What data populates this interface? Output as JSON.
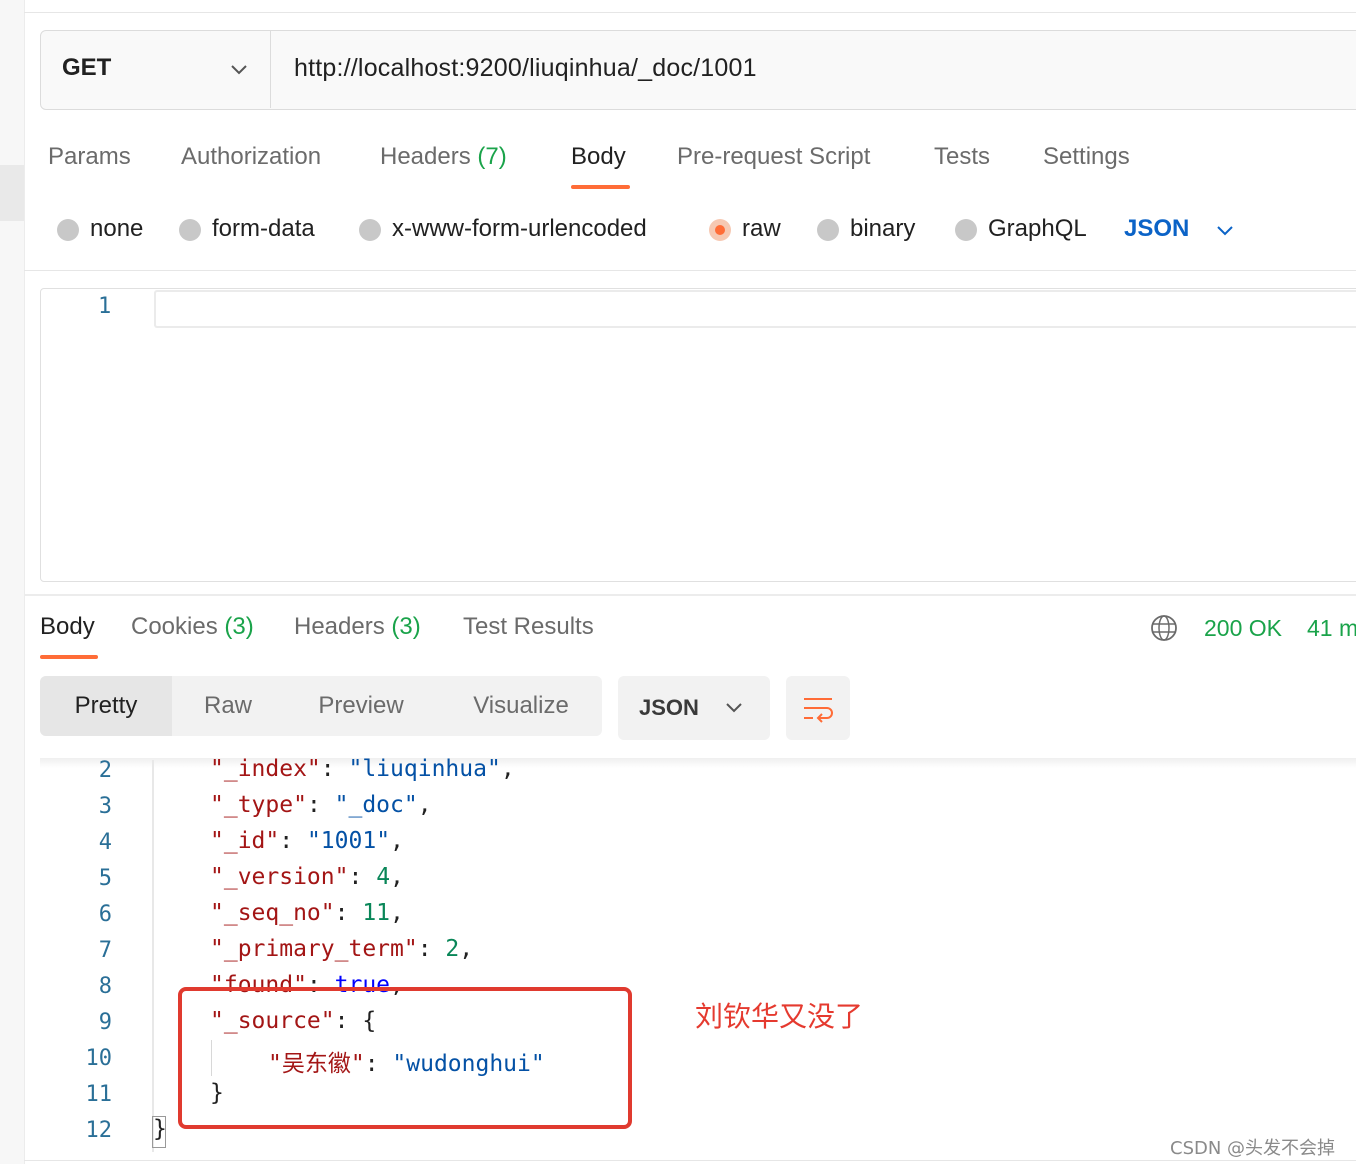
{
  "request": {
    "method": "GET",
    "url": "http://localhost:9200/liuqinhua/_doc/1001"
  },
  "request_tabs": [
    {
      "label": "Params",
      "count": ""
    },
    {
      "label": "Authorization",
      "count": ""
    },
    {
      "label": "Headers",
      "count": "(7)"
    },
    {
      "label": "Body",
      "count": "",
      "active": true
    },
    {
      "label": "Pre-request Script",
      "count": ""
    },
    {
      "label": "Tests",
      "count": ""
    },
    {
      "label": "Settings",
      "count": ""
    }
  ],
  "body_types": [
    {
      "label": "none",
      "selected": false
    },
    {
      "label": "form-data",
      "selected": false
    },
    {
      "label": "x-www-form-urlencoded",
      "selected": false
    },
    {
      "label": "raw",
      "selected": true
    },
    {
      "label": "binary",
      "selected": false
    },
    {
      "label": "GraphQL",
      "selected": false
    }
  ],
  "raw_format": "JSON",
  "editor": {
    "line_number": "1"
  },
  "response_tabs": [
    {
      "label": "Body",
      "count": "",
      "active": true
    },
    {
      "label": "Cookies",
      "count": "(3)"
    },
    {
      "label": "Headers",
      "count": "(3)"
    },
    {
      "label": "Test Results",
      "count": ""
    }
  ],
  "response_status": "200 OK",
  "response_time": "41 m",
  "view_modes": [
    "Pretty",
    "Raw",
    "Preview",
    "Visualize"
  ],
  "response_format": "JSON",
  "response_lines": [
    {
      "n": "2",
      "key": "\"_index\"",
      "value": "\"liuqinhua\"",
      "vtype": "s",
      "tail": ","
    },
    {
      "n": "3",
      "key": "\"_type\"",
      "value": "\"_doc\"",
      "vtype": "s",
      "tail": ","
    },
    {
      "n": "4",
      "key": "\"_id\"",
      "value": "\"1001\"",
      "vtype": "s",
      "tail": ","
    },
    {
      "n": "5",
      "key": "\"_version\"",
      "value": "4",
      "vtype": "n",
      "tail": ","
    },
    {
      "n": "6",
      "key": "\"_seq_no\"",
      "value": "11",
      "vtype": "n",
      "tail": ","
    },
    {
      "n": "7",
      "key": "\"_primary_term\"",
      "value": "2",
      "vtype": "n",
      "tail": ","
    },
    {
      "n": "8",
      "key": "\"found\"",
      "value": "true",
      "vtype": "b",
      "tail": ","
    },
    {
      "n": "9",
      "key": "\"_source\"",
      "value": "{",
      "vtype": "p",
      "tail": ""
    },
    {
      "n": "10",
      "key": "\"吴东徽\"",
      "value": "\"wudonghui\"",
      "vtype": "s",
      "tail": ""
    },
    {
      "n": "11",
      "key": "",
      "value": "}",
      "vtype": "p",
      "tail": ""
    },
    {
      "n": "12",
      "key": "",
      "value": "}",
      "vtype": "p",
      "tail": ""
    }
  ],
  "annotation": "刘钦华又没了",
  "watermark": "CSDN @头发不会掉",
  "colors": {
    "accent": "#ff6c37",
    "success": "#1aa34a",
    "link": "#0b63c7",
    "annotation": "#e03a2f"
  }
}
